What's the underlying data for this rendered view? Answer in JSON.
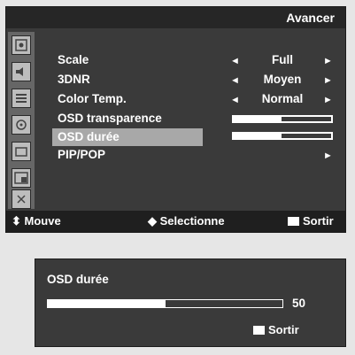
{
  "menu": {
    "title": "Avancer",
    "items": [
      {
        "label": "Scale",
        "value": "Full"
      },
      {
        "label": "3DNR",
        "value": "Moyen"
      },
      {
        "label": "Color Temp.",
        "value": "Normal"
      },
      {
        "label": "OSD transparence",
        "level": 0.5
      },
      {
        "label": "OSD durée",
        "level": 0.5
      },
      {
        "label": "PIP/POP"
      }
    ],
    "arrows": {
      "left": "◄",
      "right": "►"
    },
    "footer": {
      "move_icon": "⬍",
      "move": "Mouve",
      "select_icon": "◆",
      "select": "Selectionne",
      "exit": "Sortir"
    }
  },
  "sub": {
    "title": "OSD durée",
    "value": "50",
    "level": 0.5,
    "exit": "Sortir"
  },
  "colors": {
    "panel": "#3a3a3a",
    "selected": "#a8a8a8",
    "text": "#ffffff"
  }
}
